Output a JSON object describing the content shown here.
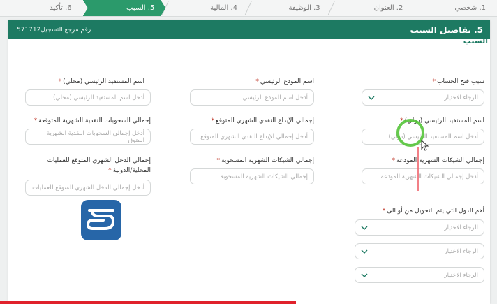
{
  "steps": [
    {
      "label": "1. شخصي"
    },
    {
      "label": "2. العنوان"
    },
    {
      "label": "3. الوظيفة"
    },
    {
      "label": "4. المالية"
    },
    {
      "label": "5. السبب"
    },
    {
      "label": "6. تأكيد"
    }
  ],
  "panel": {
    "title": "5. تفاصيل السبب",
    "reference": "رقم مرجع التسجيل571712"
  },
  "section_title": "السبب",
  "fields": {
    "account_reason": {
      "label": "سبب فتح الحساب",
      "placeholder": "الرجاء الاختيار"
    },
    "main_depositor": {
      "label": "اسم المودع الرئيسي",
      "placeholder": "أدخل اسم المودع الرئيسي"
    },
    "main_beneficiary_local": {
      "label": "اسم المستفيد الرئيسي (محلي)",
      "placeholder": "أدخل اسم المستفيد الرئيسي (محلي)"
    },
    "main_beneficiary_intl": {
      "label": "اسم المستفيد الرئيسي (دولي)",
      "placeholder": "أدخل اسم المستفيد الرئيسي (دولي)"
    },
    "expected_cash_deposit": {
      "label": "إجمالي الإيداع النقدي الشهري المتوقع",
      "placeholder": "أدخل إجمالي الإيداع النقدي الشهري المتوقع"
    },
    "expected_cash_withdrawal": {
      "label": "إجمالي السحوبات النقدية الشهرية المتوقعة",
      "placeholder": "أدخل إجمالي السحوبات النقدية الشهرية المتوق"
    },
    "deposited_checks": {
      "label": "إجمالي الشيكات الشهرية المودعة",
      "placeholder": "أدخل إجمالي الشيكات الشهرية المودعة"
    },
    "withdrawn_checks": {
      "label": "إجمالي الشيكات الشهرية المسحوبة",
      "placeholder": "إجمالي الشيكات الشهرية المسحوبة"
    },
    "expected_income": {
      "label": "إجمالي الدخل الشهري المتوقع للعمليات المحلية/الدولية",
      "placeholder": "أدخل إجمالي الدخل الشهري المتوقع للعمليات"
    },
    "transfer_countries": {
      "label": "أهم الدول التي يتم التحويل من أو الى",
      "placeholder": "الرجاء الاختيار"
    }
  },
  "colors": {
    "accent": "#1d7a62",
    "active_step": "#2b9a6b",
    "required": "#c0392b"
  },
  "icons": {
    "select_chevron": "chevron-down-icon",
    "logo": "brand-logo"
  }
}
